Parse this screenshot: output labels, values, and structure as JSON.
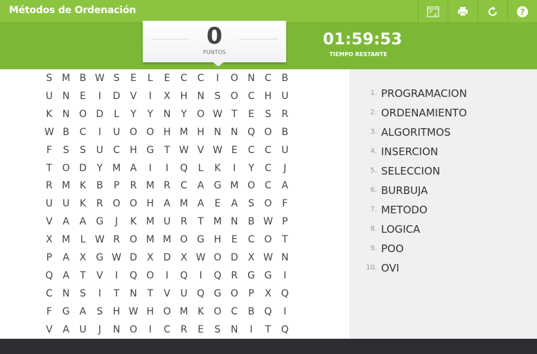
{
  "app": {
    "title": "Métodos de Ordenación",
    "toolbar": [
      {
        "icon": "fullscreen-icon"
      },
      {
        "icon": "print-icon"
      },
      {
        "icon": "restart-icon"
      },
      {
        "icon": "help-icon"
      }
    ]
  },
  "score": {
    "value": "0",
    "label": "PUNTOS"
  },
  "timer": {
    "value": "01:59:53",
    "label": "TIEMPO RESTANTE"
  },
  "grid": {
    "rows": [
      "SMBWSELECCIONCB",
      "UNEIDVIXHNSOCHU",
      "KNODLYYNYOWTESR",
      "WBCIUOOHMHNNQOB",
      "FSSUCHGTWVWECCU",
      "TODYMAIIQLKIYCJ",
      "RMKBPRMRCAGMOCA",
      "UUKROOHAMAEASOF",
      "VAAGJKMURTMNBWP",
      "XMLWROMMOGHECOT",
      "PAXGWDXDXWODXWN",
      "QATVIQOIQIQRGGI",
      "CNSITNTVUQGOPXQ",
      "FGASHWHOMKOCBQI",
      "VAUJNOICRESNITQ"
    ]
  },
  "words": [
    {
      "num": "1.",
      "text": "PROGRAMACION"
    },
    {
      "num": "2.",
      "text": "ORDENAMIENTO"
    },
    {
      "num": "3.",
      "text": "ALGORITMOS"
    },
    {
      "num": "4.",
      "text": "INSERCION"
    },
    {
      "num": "5.",
      "text": "SELECCION"
    },
    {
      "num": "6.",
      "text": "BURBUJA"
    },
    {
      "num": "7.",
      "text": "METODO"
    },
    {
      "num": "8.",
      "text": "LOGICA"
    },
    {
      "num": "9.",
      "text": "POO"
    },
    {
      "num": "10.",
      "text": "OVI"
    }
  ],
  "colors": {
    "header": "#8bc53f",
    "band": "#7cb836",
    "footer": "#2c2e32",
    "panel": "#f0f0f0"
  }
}
